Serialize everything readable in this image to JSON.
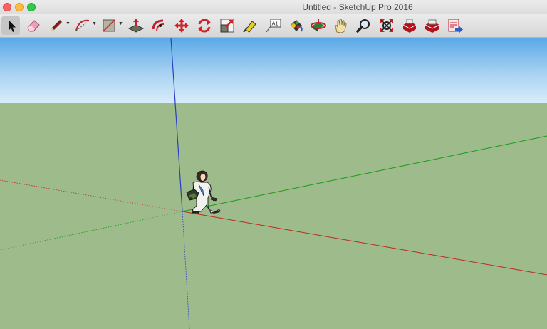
{
  "window": {
    "title": "Untitled - SketchUp Pro 2016"
  },
  "toolbar": {
    "tools": [
      {
        "name": "select-tool",
        "icon": "arrow-cursor-icon"
      },
      {
        "name": "eraser-tool",
        "icon": "eraser-icon"
      },
      {
        "name": "line-tool",
        "icon": "pencil-icon"
      },
      {
        "name": "arc-tool",
        "icon": "arc-icon"
      },
      {
        "name": "shape-tool",
        "icon": "rectangle-icon"
      },
      {
        "name": "push-pull-tool",
        "icon": "push-pull-icon"
      },
      {
        "name": "offset-tool",
        "icon": "offset-icon"
      },
      {
        "name": "move-tool",
        "icon": "move-arrows-icon"
      },
      {
        "name": "rotate-tool",
        "icon": "rotate-icon"
      },
      {
        "name": "scale-tool",
        "icon": "scale-icon"
      },
      {
        "name": "tape-measure-tool",
        "icon": "tape-measure-icon"
      },
      {
        "name": "text-tool",
        "icon": "text-label-icon"
      },
      {
        "name": "paint-bucket-tool",
        "icon": "paint-bucket-icon"
      },
      {
        "name": "orbit-tool",
        "icon": "orbit-icon"
      },
      {
        "name": "pan-tool",
        "icon": "hand-icon"
      },
      {
        "name": "zoom-tool",
        "icon": "magnifier-icon"
      },
      {
        "name": "zoom-extents-tool",
        "icon": "zoom-extents-icon"
      },
      {
        "name": "3d-warehouse-tool",
        "icon": "warehouse-icon"
      },
      {
        "name": "extension-warehouse-tool",
        "icon": "extension-icon"
      },
      {
        "name": "send-to-layout-tool",
        "icon": "layout-icon"
      }
    ]
  },
  "text_label_icon_text": "A1",
  "colors": {
    "sky_top": "#5aa8e6",
    "ground": "#9dbb8b",
    "x_axis": "#c1281c",
    "y_axis": "#1a9a1a",
    "z_axis": "#2a3fc8"
  }
}
